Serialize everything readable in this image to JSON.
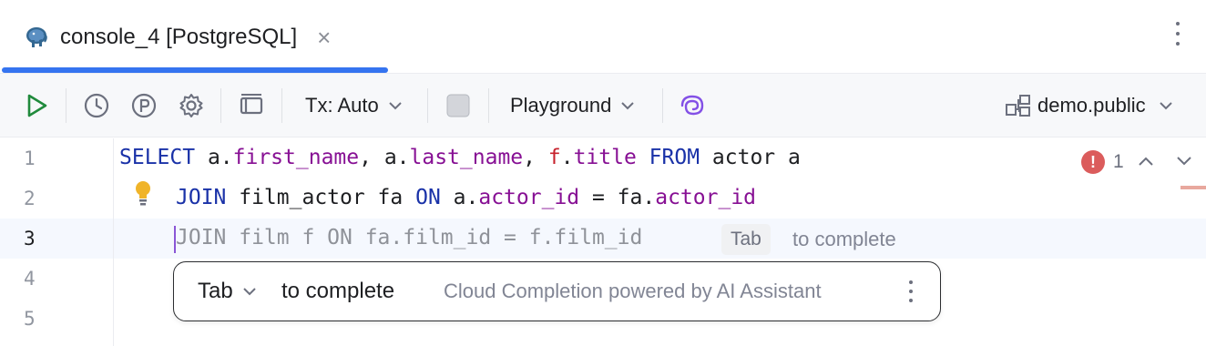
{
  "tab": {
    "title": "console_4 [PostgreSQL]",
    "close_glyph": "×",
    "icon": "postgresql-elephant-icon",
    "accent": "#3574f0"
  },
  "toolbar": {
    "tx_label": "Tx: Auto",
    "playground_label": "Playground",
    "schema_label": "demo.public",
    "run_color": "#208a3c"
  },
  "editor": {
    "line_numbers": [
      "1",
      "2",
      "3",
      "4",
      "5"
    ],
    "line1": {
      "select": "SELECT",
      "a1": " a.",
      "first_name": "first_name",
      "sep1": ", a.",
      "last_name": "last_name",
      "sep2": ", ",
      "f": "f",
      "dot": ".",
      "title": "title",
      "from": " FROM",
      "rest": " actor a"
    },
    "line2": {
      "join": "JOIN",
      "mid1": " film_actor fa ",
      "on": "ON",
      "mid2": " a.",
      "actor_id": "actor_id",
      "mid3": " = fa.",
      "actor_id2": "actor_id"
    },
    "line3_ghost": "JOIN film f ON fa.film_id = f.film_id",
    "inline_key": "Tab",
    "inline_hint": "to complete",
    "problems_count": "1",
    "error_color": "#db5c5c"
  },
  "popup": {
    "key": "Tab",
    "action": "to complete",
    "info": "Cloud Completion powered by AI Assistant"
  }
}
